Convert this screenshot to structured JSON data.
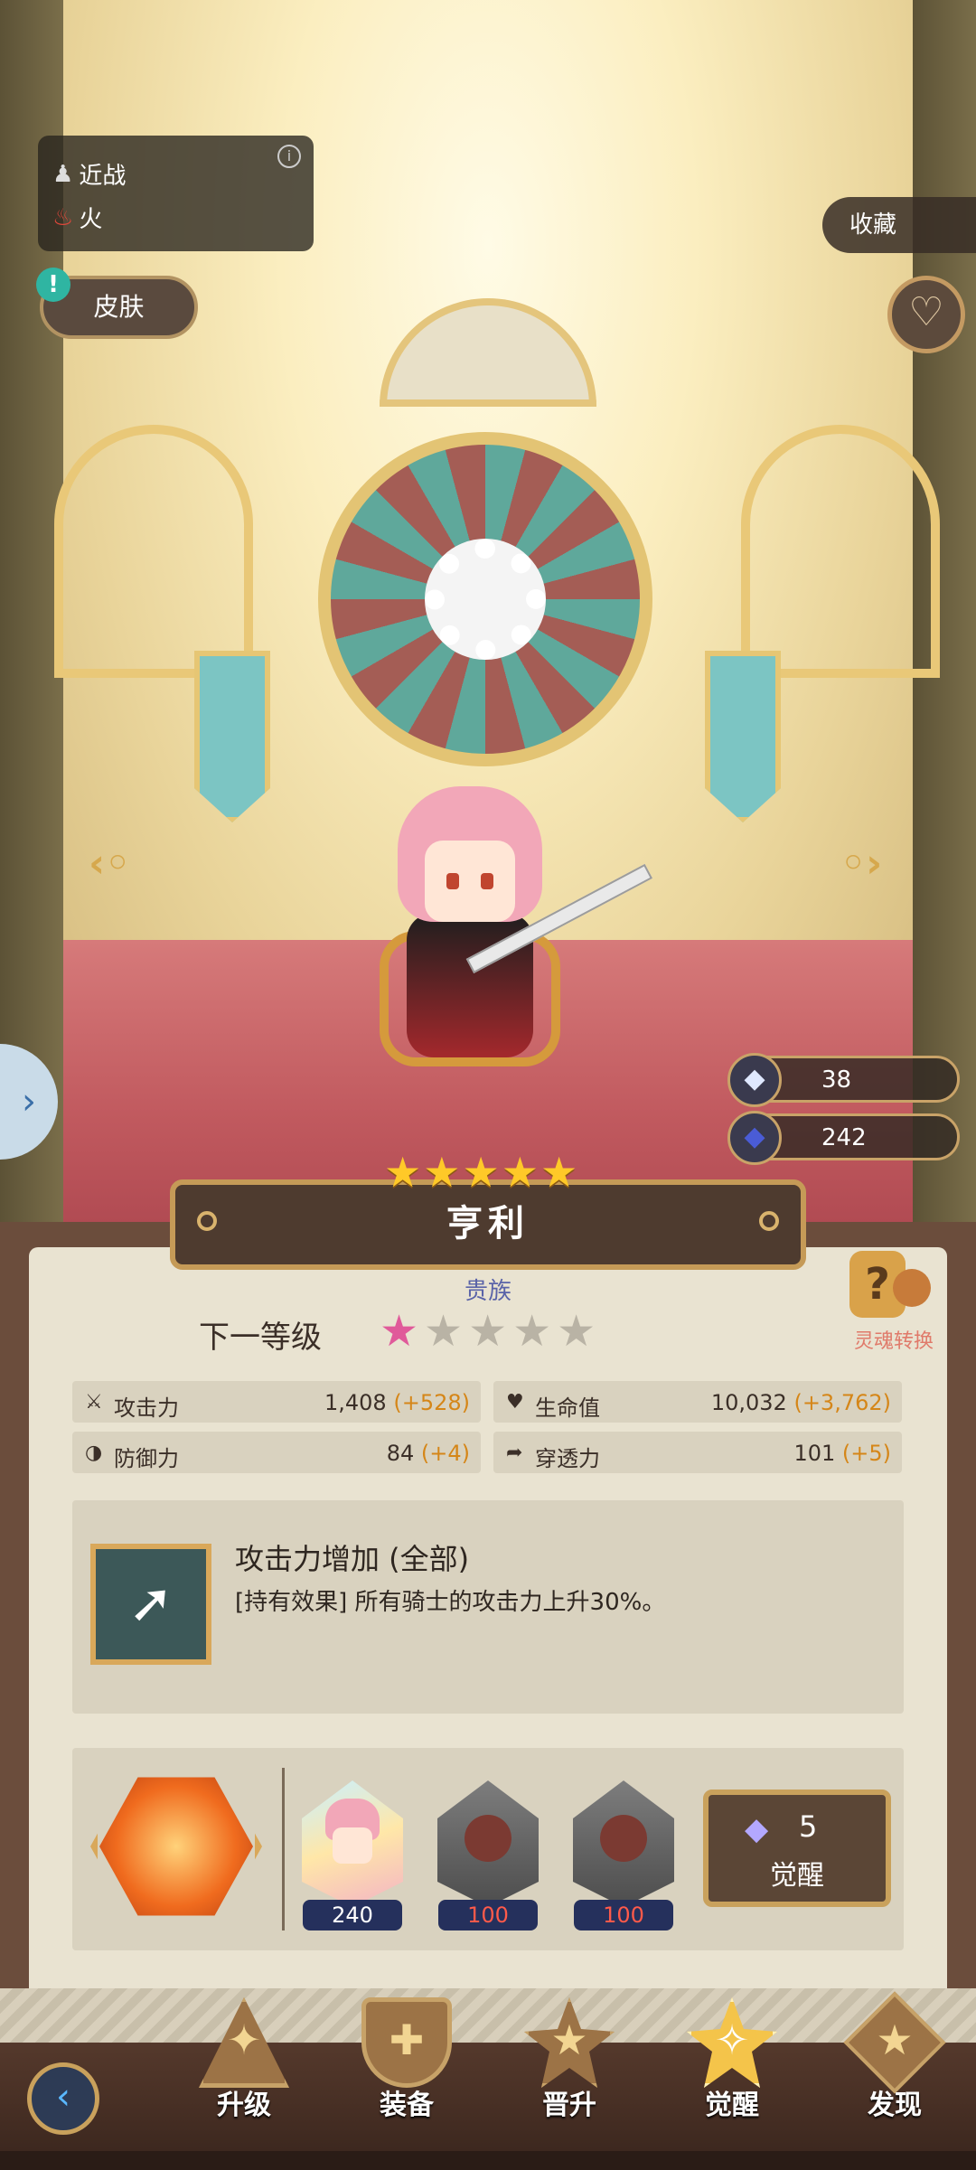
{
  "character": {
    "name": "亨利",
    "rank_label": "贵族",
    "star_count": 5,
    "attack_type": "近战",
    "element": "火"
  },
  "buttons": {
    "skin": "皮肤",
    "collect": "收藏"
  },
  "currencies": [
    {
      "icon": "crystal-icon",
      "value": "38"
    },
    {
      "icon": "blue-gem-icon",
      "value": "242"
    }
  ],
  "next_level": {
    "label": "下一等级",
    "filled_stars": 1,
    "total_stars": 5
  },
  "soul_convert_label": "灵魂转换",
  "stats": [
    {
      "icon": "sword-icon",
      "name": "攻击力",
      "value": "1,408",
      "bonus": "(+528)"
    },
    {
      "icon": "heart-shield-icon",
      "name": "生命值",
      "value": "10,032",
      "bonus": "(+3,762)"
    },
    {
      "icon": "defense-icon",
      "name": "防御力",
      "value": "84",
      "bonus": "(+4)"
    },
    {
      "icon": "penetration-icon",
      "name": "穿透力",
      "value": "101",
      "bonus": "(+5)"
    }
  ],
  "effect": {
    "title": "攻击力增加 (全部)",
    "description": "[持有效果] 所有骑士的攻击力上升30%。"
  },
  "awaken": {
    "materials": [
      {
        "type": "character-shard",
        "count": "240",
        "insufficient": false
      },
      {
        "type": "fire-stone",
        "count": "100",
        "insufficient": true
      },
      {
        "type": "fire-stone",
        "count": "100",
        "insufficient": true
      }
    ],
    "cost": "5",
    "button_label": "觉醒"
  },
  "nav": [
    {
      "label": "升级",
      "icon": "upgrade-icon",
      "active": false
    },
    {
      "label": "装备",
      "icon": "equipment-icon",
      "active": false
    },
    {
      "label": "晋升",
      "icon": "promote-icon",
      "active": false
    },
    {
      "label": "觉醒",
      "icon": "awaken-icon",
      "active": true
    },
    {
      "label": "发现",
      "icon": "discover-icon",
      "active": false
    }
  ],
  "colors": {
    "accent_gold": "#c9a15c",
    "panel_bg": "#e9e3d1",
    "bonus_orange": "#d58618",
    "rank_blue": "#5a63a8",
    "insufficient_red": "#ff5a4a"
  }
}
